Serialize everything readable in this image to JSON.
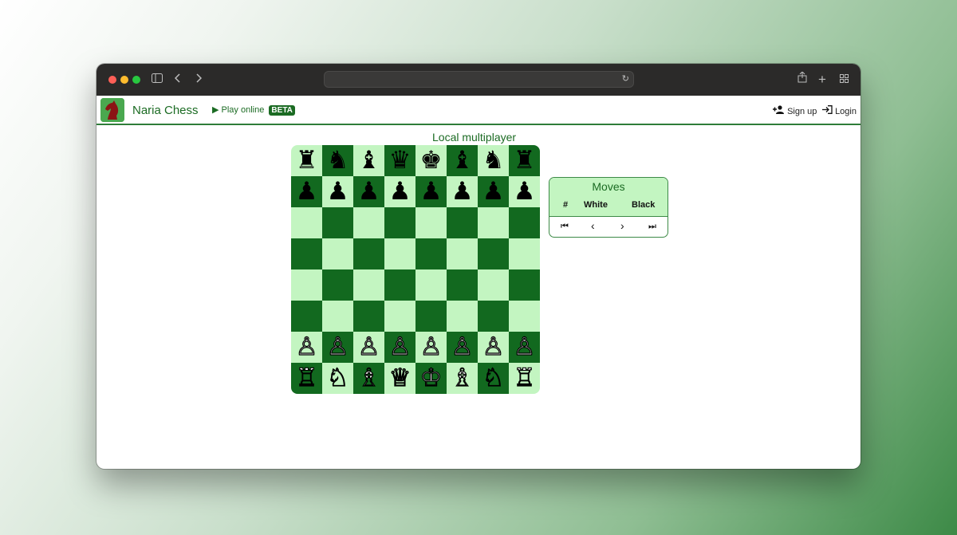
{
  "site": {
    "brand": "Naria Chess",
    "play_online": "Play online",
    "beta": "BETA",
    "signup": "Sign up",
    "login": "Login",
    "mode_title": "Local multiplayer"
  },
  "moves_panel": {
    "title": "Moves",
    "col_num": "#",
    "col_white": "White",
    "col_black": "Black",
    "nav_first": "⏮",
    "nav_prev": "‹",
    "nav_next": "›",
    "nav_last": "⏭"
  },
  "board": {
    "rows": [
      [
        "♜",
        "♞",
        "♝",
        "♛",
        "♚",
        "♝",
        "♞",
        "♜"
      ],
      [
        "♟",
        "♟",
        "♟",
        "♟",
        "♟",
        "♟",
        "♟",
        "♟"
      ],
      [
        "",
        "",
        "",
        "",
        "",
        "",
        "",
        ""
      ],
      [
        "",
        "",
        "",
        "",
        "",
        "",
        "",
        ""
      ],
      [
        "",
        "",
        "",
        "",
        "",
        "",
        "",
        ""
      ],
      [
        "",
        "",
        "",
        "",
        "",
        "",
        "",
        ""
      ],
      [
        "♙",
        "♙",
        "♙",
        "♙",
        "♙",
        "♙",
        "♙",
        "♙"
      ],
      [
        "♖",
        "♘",
        "♗",
        "♕",
        "♔",
        "♗",
        "♘",
        "♖"
      ]
    ],
    "colors": {
      "light": "#c3f5c1",
      "dark": "#12691f"
    }
  },
  "colors": {
    "brand": "#1b6b23",
    "accent": "#3d8a47"
  }
}
